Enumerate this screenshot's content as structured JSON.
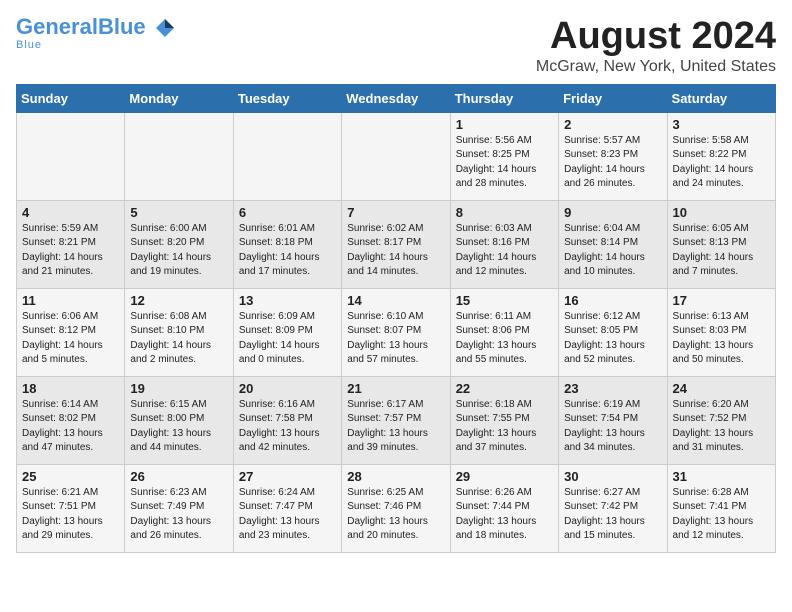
{
  "header": {
    "logo_general": "General",
    "logo_blue": "Blue",
    "month_title": "August 2024",
    "location": "McGraw, New York, United States"
  },
  "weekdays": [
    "Sunday",
    "Monday",
    "Tuesday",
    "Wednesday",
    "Thursday",
    "Friday",
    "Saturday"
  ],
  "weeks": [
    [
      {
        "day": "",
        "info": ""
      },
      {
        "day": "",
        "info": ""
      },
      {
        "day": "",
        "info": ""
      },
      {
        "day": "",
        "info": ""
      },
      {
        "day": "1",
        "info": "Sunrise: 5:56 AM\nSunset: 8:25 PM\nDaylight: 14 hours\nand 28 minutes."
      },
      {
        "day": "2",
        "info": "Sunrise: 5:57 AM\nSunset: 8:23 PM\nDaylight: 14 hours\nand 26 minutes."
      },
      {
        "day": "3",
        "info": "Sunrise: 5:58 AM\nSunset: 8:22 PM\nDaylight: 14 hours\nand 24 minutes."
      }
    ],
    [
      {
        "day": "4",
        "info": "Sunrise: 5:59 AM\nSunset: 8:21 PM\nDaylight: 14 hours\nand 21 minutes."
      },
      {
        "day": "5",
        "info": "Sunrise: 6:00 AM\nSunset: 8:20 PM\nDaylight: 14 hours\nand 19 minutes."
      },
      {
        "day": "6",
        "info": "Sunrise: 6:01 AM\nSunset: 8:18 PM\nDaylight: 14 hours\nand 17 minutes."
      },
      {
        "day": "7",
        "info": "Sunrise: 6:02 AM\nSunset: 8:17 PM\nDaylight: 14 hours\nand 14 minutes."
      },
      {
        "day": "8",
        "info": "Sunrise: 6:03 AM\nSunset: 8:16 PM\nDaylight: 14 hours\nand 12 minutes."
      },
      {
        "day": "9",
        "info": "Sunrise: 6:04 AM\nSunset: 8:14 PM\nDaylight: 14 hours\nand 10 minutes."
      },
      {
        "day": "10",
        "info": "Sunrise: 6:05 AM\nSunset: 8:13 PM\nDaylight: 14 hours\nand 7 minutes."
      }
    ],
    [
      {
        "day": "11",
        "info": "Sunrise: 6:06 AM\nSunset: 8:12 PM\nDaylight: 14 hours\nand 5 minutes."
      },
      {
        "day": "12",
        "info": "Sunrise: 6:08 AM\nSunset: 8:10 PM\nDaylight: 14 hours\nand 2 minutes."
      },
      {
        "day": "13",
        "info": "Sunrise: 6:09 AM\nSunset: 8:09 PM\nDaylight: 14 hours\nand 0 minutes."
      },
      {
        "day": "14",
        "info": "Sunrise: 6:10 AM\nSunset: 8:07 PM\nDaylight: 13 hours\nand 57 minutes."
      },
      {
        "day": "15",
        "info": "Sunrise: 6:11 AM\nSunset: 8:06 PM\nDaylight: 13 hours\nand 55 minutes."
      },
      {
        "day": "16",
        "info": "Sunrise: 6:12 AM\nSunset: 8:05 PM\nDaylight: 13 hours\nand 52 minutes."
      },
      {
        "day": "17",
        "info": "Sunrise: 6:13 AM\nSunset: 8:03 PM\nDaylight: 13 hours\nand 50 minutes."
      }
    ],
    [
      {
        "day": "18",
        "info": "Sunrise: 6:14 AM\nSunset: 8:02 PM\nDaylight: 13 hours\nand 47 minutes."
      },
      {
        "day": "19",
        "info": "Sunrise: 6:15 AM\nSunset: 8:00 PM\nDaylight: 13 hours\nand 44 minutes."
      },
      {
        "day": "20",
        "info": "Sunrise: 6:16 AM\nSunset: 7:58 PM\nDaylight: 13 hours\nand 42 minutes."
      },
      {
        "day": "21",
        "info": "Sunrise: 6:17 AM\nSunset: 7:57 PM\nDaylight: 13 hours\nand 39 minutes."
      },
      {
        "day": "22",
        "info": "Sunrise: 6:18 AM\nSunset: 7:55 PM\nDaylight: 13 hours\nand 37 minutes."
      },
      {
        "day": "23",
        "info": "Sunrise: 6:19 AM\nSunset: 7:54 PM\nDaylight: 13 hours\nand 34 minutes."
      },
      {
        "day": "24",
        "info": "Sunrise: 6:20 AM\nSunset: 7:52 PM\nDaylight: 13 hours\nand 31 minutes."
      }
    ],
    [
      {
        "day": "25",
        "info": "Sunrise: 6:21 AM\nSunset: 7:51 PM\nDaylight: 13 hours\nand 29 minutes."
      },
      {
        "day": "26",
        "info": "Sunrise: 6:23 AM\nSunset: 7:49 PM\nDaylight: 13 hours\nand 26 minutes."
      },
      {
        "day": "27",
        "info": "Sunrise: 6:24 AM\nSunset: 7:47 PM\nDaylight: 13 hours\nand 23 minutes."
      },
      {
        "day": "28",
        "info": "Sunrise: 6:25 AM\nSunset: 7:46 PM\nDaylight: 13 hours\nand 20 minutes."
      },
      {
        "day": "29",
        "info": "Sunrise: 6:26 AM\nSunset: 7:44 PM\nDaylight: 13 hours\nand 18 minutes."
      },
      {
        "day": "30",
        "info": "Sunrise: 6:27 AM\nSunset: 7:42 PM\nDaylight: 13 hours\nand 15 minutes."
      },
      {
        "day": "31",
        "info": "Sunrise: 6:28 AM\nSunset: 7:41 PM\nDaylight: 13 hours\nand 12 minutes."
      }
    ]
  ]
}
